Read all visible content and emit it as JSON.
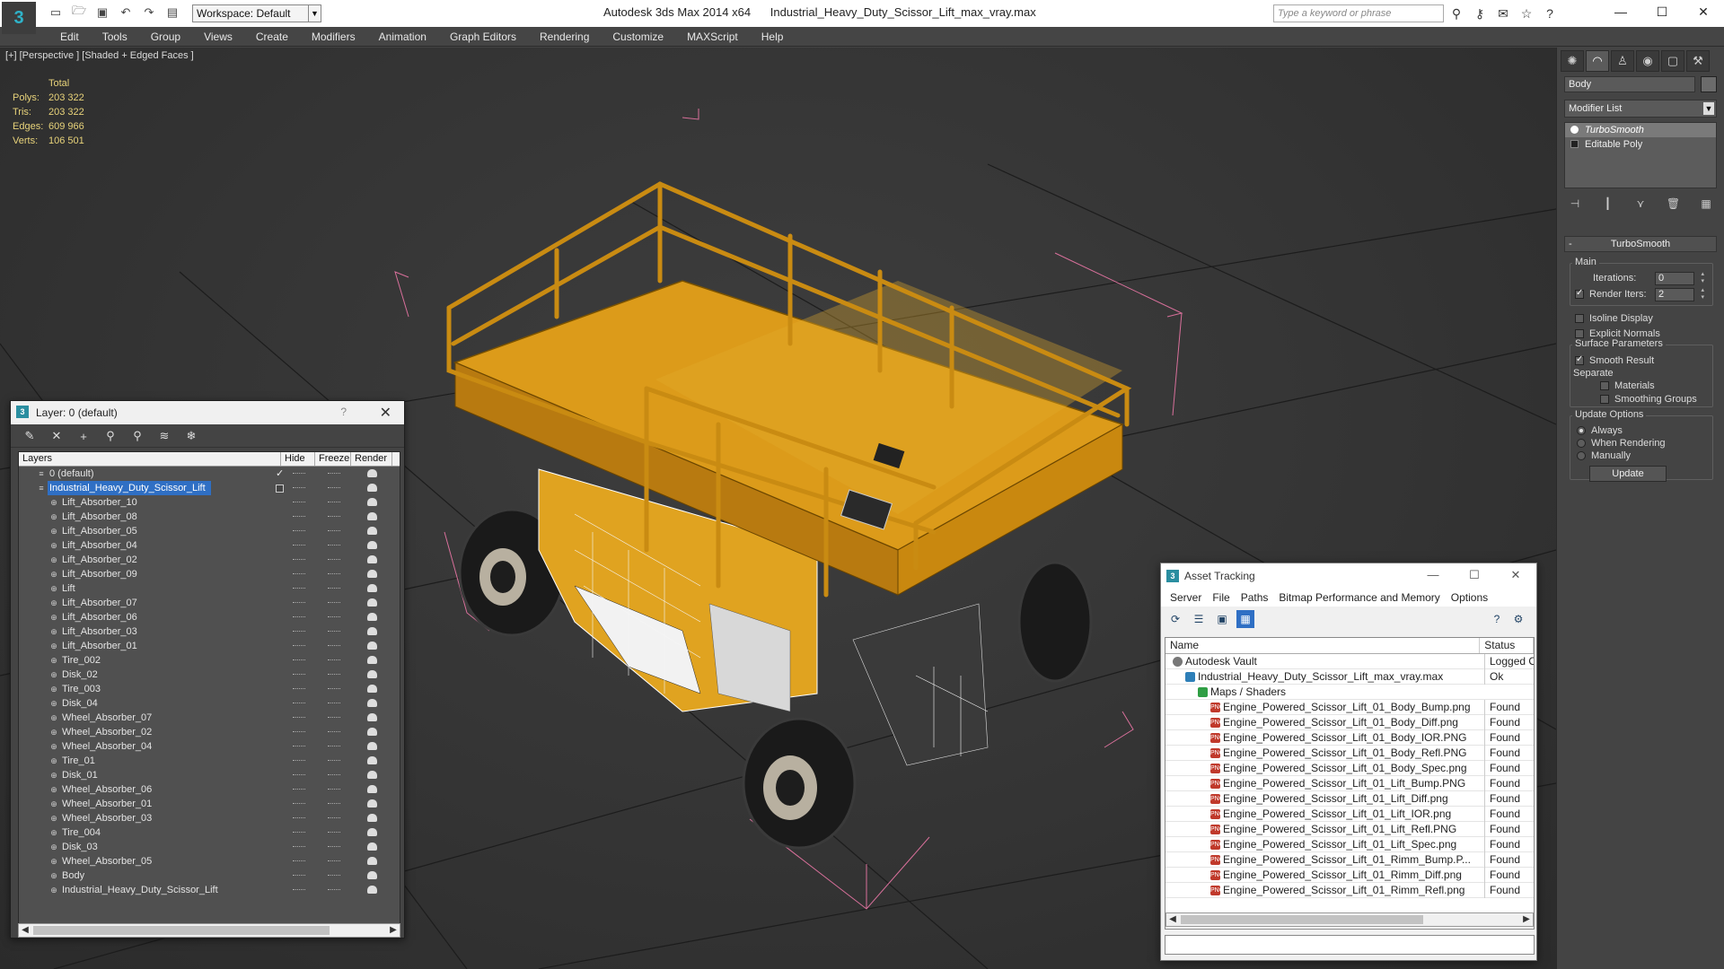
{
  "titlebar": {
    "workspace": "Workspace: Default",
    "app_version": "Autodesk 3ds Max 2014 x64",
    "filename": "Industrial_Heavy_Duty_Scissor_Lift_max_vray.max",
    "search_placeholder": "Type a keyword or phrase"
  },
  "menubar": {
    "items": [
      "Edit",
      "Tools",
      "Group",
      "Views",
      "Create",
      "Modifiers",
      "Animation",
      "Graph Editors",
      "Rendering",
      "Customize",
      "MAXScript",
      "Help"
    ]
  },
  "viewport": {
    "label": "[+] [Perspective ] [Shaded + Edged Faces ]",
    "stats": {
      "header": "Total",
      "rows": [
        {
          "label": "Polys:",
          "value": "203 322"
        },
        {
          "label": "Tris:",
          "value": "203 322"
        },
        {
          "label": "Edges:",
          "value": "609 966"
        },
        {
          "label": "Verts:",
          "value": "106 501"
        }
      ]
    }
  },
  "command_panel": {
    "object_name": "Body",
    "modifier_list": "Modifier List",
    "stack": [
      "TurboSmooth",
      "Editable Poly"
    ],
    "rollout_title": "TurboSmooth",
    "main_group": "Main",
    "iterations_label": "Iterations:",
    "iterations_value": "0",
    "render_iters_label": "Render Iters:",
    "render_iters_value": "2",
    "isoline": "Isoline Display",
    "explicit_normals": "Explicit Normals",
    "surface_group": "Surface Parameters",
    "smooth_result": "Smooth Result",
    "separate": "Separate",
    "materials": "Materials",
    "smoothing_groups": "Smoothing Groups",
    "update_group": "Update Options",
    "always": "Always",
    "when_rendering": "When Rendering",
    "manually": "Manually",
    "update_button": "Update"
  },
  "layer_window": {
    "title": "Layer: 0 (default)",
    "help": "?",
    "columns": [
      "Layers",
      "Hide",
      "Freeze",
      "Render"
    ],
    "default_layer": "0 (default)",
    "selected_layer": "Industrial_Heavy_Duty_Scissor_Lift",
    "objects": [
      "Lift_Absorber_10",
      "Lift_Absorber_08",
      "Lift_Absorber_05",
      "Lift_Absorber_04",
      "Lift_Absorber_02",
      "Lift_Absorber_09",
      "Lift",
      "Lift_Absorber_07",
      "Lift_Absorber_06",
      "Lift_Absorber_03",
      "Lift_Absorber_01",
      "Tire_002",
      "Disk_02",
      "Tire_003",
      "Disk_04",
      "Wheel_Absorber_07",
      "Wheel_Absorber_02",
      "Wheel_Absorber_04",
      "Tire_01",
      "Disk_01",
      "Wheel_Absorber_06",
      "Wheel_Absorber_01",
      "Wheel_Absorber_03",
      "Tire_004",
      "Disk_03",
      "Wheel_Absorber_05",
      "Body",
      "Industrial_Heavy_Duty_Scissor_Lift"
    ]
  },
  "asset_window": {
    "title": "Asset Tracking",
    "menu": [
      "Server",
      "File",
      "Paths",
      "Bitmap Performance and Memory",
      "Options"
    ],
    "columns": [
      "Name",
      "Status"
    ],
    "rows": [
      {
        "name": "Autodesk Vault",
        "status": "Logged O",
        "level": 0,
        "icon": "vault"
      },
      {
        "name": "Industrial_Heavy_Duty_Scissor_Lift_max_vray.max",
        "status": "Ok",
        "level": 1,
        "icon": "max"
      },
      {
        "name": "Maps / Shaders",
        "status": "",
        "level": 2,
        "icon": "maps"
      },
      {
        "name": "Engine_Powered_Scissor_Lift_01_Body_Bump.png",
        "status": "Found",
        "level": 3,
        "icon": "png"
      },
      {
        "name": "Engine_Powered_Scissor_Lift_01_Body_Diff.png",
        "status": "Found",
        "level": 3,
        "icon": "png"
      },
      {
        "name": "Engine_Powered_Scissor_Lift_01_Body_IOR.PNG",
        "status": "Found",
        "level": 3,
        "icon": "png"
      },
      {
        "name": "Engine_Powered_Scissor_Lift_01_Body_Refl.PNG",
        "status": "Found",
        "level": 3,
        "icon": "png"
      },
      {
        "name": "Engine_Powered_Scissor_Lift_01_Body_Spec.png",
        "status": "Found",
        "level": 3,
        "icon": "png"
      },
      {
        "name": "Engine_Powered_Scissor_Lift_01_Lift_Bump.PNG",
        "status": "Found",
        "level": 3,
        "icon": "png"
      },
      {
        "name": "Engine_Powered_Scissor_Lift_01_Lift_Diff.png",
        "status": "Found",
        "level": 3,
        "icon": "png"
      },
      {
        "name": "Engine_Powered_Scissor_Lift_01_Lift_IOR.png",
        "status": "Found",
        "level": 3,
        "icon": "png"
      },
      {
        "name": "Engine_Powered_Scissor_Lift_01_Lift_Refl.PNG",
        "status": "Found",
        "level": 3,
        "icon": "png"
      },
      {
        "name": "Engine_Powered_Scissor_Lift_01_Lift_Spec.png",
        "status": "Found",
        "level": 3,
        "icon": "png"
      },
      {
        "name": "Engine_Powered_Scissor_Lift_01_Rimm_Bump.P...",
        "status": "Found",
        "level": 3,
        "icon": "png"
      },
      {
        "name": "Engine_Powered_Scissor_Lift_01_Rimm_Diff.png",
        "status": "Found",
        "level": 3,
        "icon": "png"
      },
      {
        "name": "Engine_Powered_Scissor_Lift_01_Rimm_Refl.png",
        "status": "Found",
        "level": 3,
        "icon": "png"
      }
    ]
  },
  "colors": {
    "accent": "#2f6fc4",
    "stats_text": "#e8d37a",
    "model_yellow": "#e0a320",
    "bbox_pink": "#d9709b"
  }
}
